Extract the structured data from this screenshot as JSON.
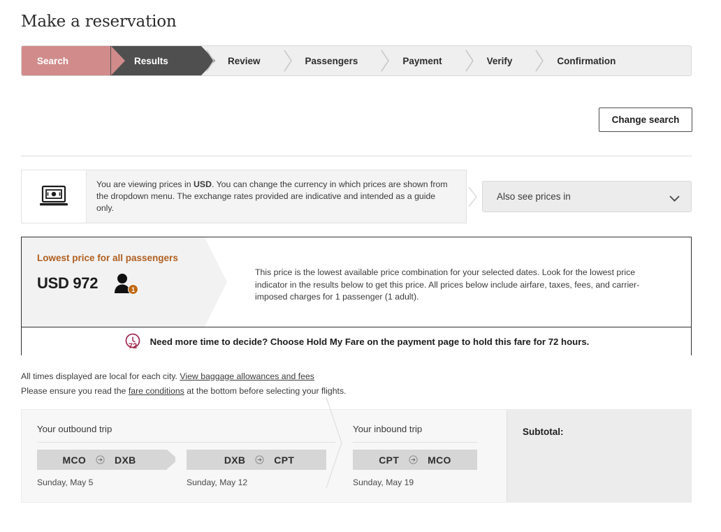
{
  "page": {
    "title": "Make a reservation"
  },
  "steps": [
    {
      "label": "Search",
      "state": "completed",
      "icon": "chevron-right-icon"
    },
    {
      "label": "Results",
      "state": "current",
      "icon": "chevron-right-icon"
    },
    {
      "label": "Review",
      "state": "upcoming",
      "icon": "chevron-right-icon"
    },
    {
      "label": "Passengers",
      "state": "upcoming",
      "icon": "chevron-right-icon"
    },
    {
      "label": "Payment",
      "state": "upcoming",
      "icon": "chevron-right-icon"
    },
    {
      "label": "Verify",
      "state": "upcoming",
      "icon": "chevron-right-icon"
    },
    {
      "label": "Confirmation",
      "state": "upcoming",
      "icon": "chevron-right-icon"
    }
  ],
  "toolbar": {
    "change_search_label": "Change search"
  },
  "currency_notice": {
    "icon": "money-on-laptop-icon",
    "text_before": "You are viewing prices in ",
    "currency": "USD",
    "text_after": ". You can change the currency in which prices are shown from the dropdown menu. The exchange rates provided are indicative and intended as a guide only.",
    "chevron_icon": "chevron-right-icon"
  },
  "also_see_prices": {
    "label": "Also see prices in",
    "chevron_icon": "chevron-down-icon"
  },
  "lowest_price": {
    "caption": "Lowest price for all passengers",
    "amount": "USD 972",
    "currency_code": "USD",
    "value": "972",
    "passenger_icon": "passenger-icon",
    "passenger_count": "1",
    "description": "This price is the lowest available price combination for your selected dates. Look for the lowest price indicator in the results below to get this price. All prices below include airfare, taxes, fees, and carrier-imposed charges for 1 passenger (1 adult).",
    "caption_color": "#b06020"
  },
  "hold_fare": {
    "icon": "clock-72-icon",
    "icon_badge": "72",
    "text": "Need more time to decide? Choose Hold My Fare on the payment page to hold this fare for 72 hours.",
    "icon_color": "#9e2a4e"
  },
  "footnotes": {
    "line1_text": "All times displayed are local for each city. ",
    "line1_link": "View baggage allowances and fees",
    "line2_before": "Please ensure you read the ",
    "line2_link": "fare conditions",
    "line2_after": " at the bottom before selecting your flights."
  },
  "trip_summary": {
    "outbound": {
      "heading": "Your outbound trip",
      "legs": [
        {
          "origin": "MCO",
          "destination": "DXB",
          "date": "Sunday, May 5",
          "arrow_icon": "circled-arrow-right-icon"
        },
        {
          "origin": "DXB",
          "destination": "CPT",
          "date": "Sunday, May 12",
          "arrow_icon": "circled-arrow-right-icon"
        }
      ]
    },
    "inbound": {
      "heading": "Your inbound trip",
      "legs": [
        {
          "origin": "CPT",
          "destination": "MCO",
          "date": "Sunday, May 19",
          "arrow_icon": "circled-arrow-right-icon"
        }
      ]
    },
    "subtotal": {
      "label": "Subtotal:",
      "value": ""
    }
  }
}
